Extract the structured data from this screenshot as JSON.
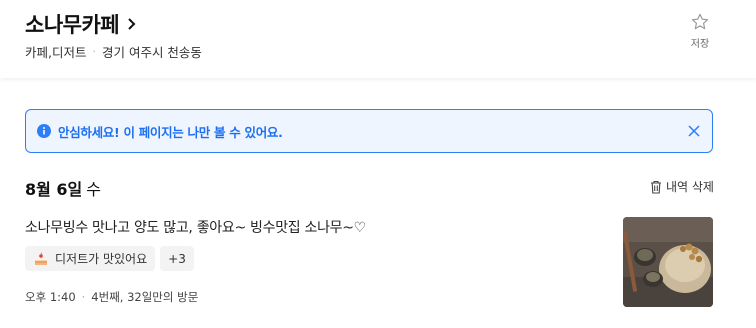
{
  "header": {
    "place_name": "소나무카페",
    "category": "카페,디저트",
    "address": "경기 여주시 천송동",
    "save_label": "저장"
  },
  "notice": {
    "text": "안심하세요! 이 페이지는 나만 볼 수 있어요."
  },
  "review": {
    "date": "8월 6일",
    "weekday": "수",
    "delete_label": "내역 삭제",
    "text": "소나무빙수 맛나고 양도 많고, 좋아요~ 빙수맛집 소나무~♡",
    "tags": [
      {
        "label": "디저트가 맛있어요",
        "icon": "cake-icon"
      }
    ],
    "more_tags": "+3",
    "visit_time": "오후 1:40",
    "visit_info": "4번째, 32일만의 방문"
  },
  "colors": {
    "accent": "#2d7ff9",
    "notice_bg": "#eef5ff",
    "notice_text": "#1d6ff2"
  }
}
